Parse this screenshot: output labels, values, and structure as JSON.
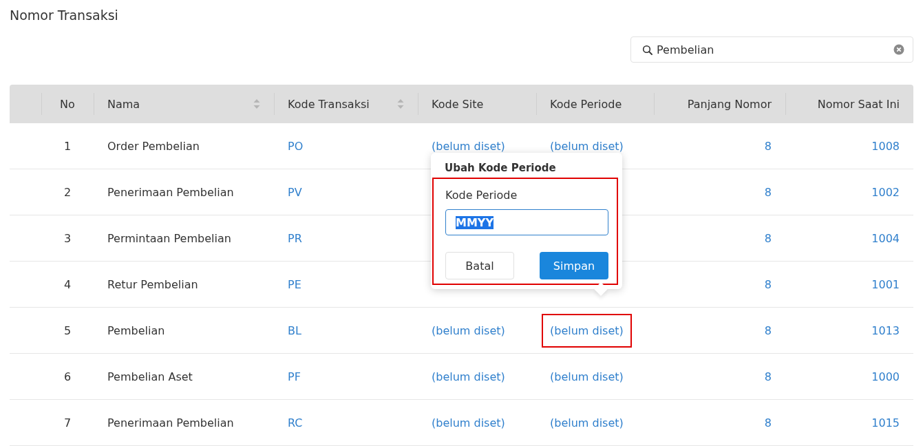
{
  "page_title": "Nomor Transaksi",
  "search": {
    "value": "Pembelian"
  },
  "table": {
    "columns": [
      {
        "label": "No"
      },
      {
        "label": "Nama",
        "sortable": true
      },
      {
        "label": "Kode Transaksi",
        "sortable": true
      },
      {
        "label": "Kode Site"
      },
      {
        "label": "Kode Periode"
      },
      {
        "label": "Panjang Nomor"
      },
      {
        "label": "Nomor Saat Ini"
      }
    ],
    "rows": [
      {
        "no": "1",
        "nama": "Order Pembelian",
        "kode_transaksi": "PO",
        "kode_site": "(belum diset)",
        "kode_periode": "(belum diset)",
        "panjang_nomor": "8",
        "nomor_saat_ini": "1008"
      },
      {
        "no": "2",
        "nama": "Penerimaan Pembelian",
        "kode_transaksi": "PV",
        "panjang_nomor": "8",
        "nomor_saat_ini": "1002"
      },
      {
        "no": "3",
        "nama": "Permintaan Pembelian",
        "kode_transaksi": "PR",
        "panjang_nomor": "8",
        "nomor_saat_ini": "1004"
      },
      {
        "no": "4",
        "nama": "Retur Pembelian",
        "kode_transaksi": "PE",
        "panjang_nomor": "8",
        "nomor_saat_ini": "1001"
      },
      {
        "no": "5",
        "nama": "Pembelian",
        "kode_transaksi": "BL",
        "kode_site": "(belum diset)",
        "kode_periode": "(belum diset)",
        "panjang_nomor": "8",
        "nomor_saat_ini": "1013",
        "highlighted": true
      },
      {
        "no": "6",
        "nama": "Pembelian Aset",
        "kode_transaksi": "PF",
        "kode_site": "(belum diset)",
        "kode_periode": "(belum diset)",
        "panjang_nomor": "8",
        "nomor_saat_ini": "1000"
      },
      {
        "no": "7",
        "nama": "Penerimaan Pembelian",
        "kode_transaksi": "RC",
        "kode_site": "(belum diset)",
        "kode_periode": "(belum diset)",
        "panjang_nomor": "8",
        "nomor_saat_ini": "1015"
      }
    ]
  },
  "popover": {
    "title": "Ubah Kode Periode",
    "highlighted": true,
    "field_label": "Kode Periode",
    "value": "MMYY",
    "value_selected": true,
    "buttons": [
      {
        "label": "Batal",
        "kind": "secondary"
      },
      {
        "label": "Simpan",
        "kind": "primary"
      }
    ]
  }
}
